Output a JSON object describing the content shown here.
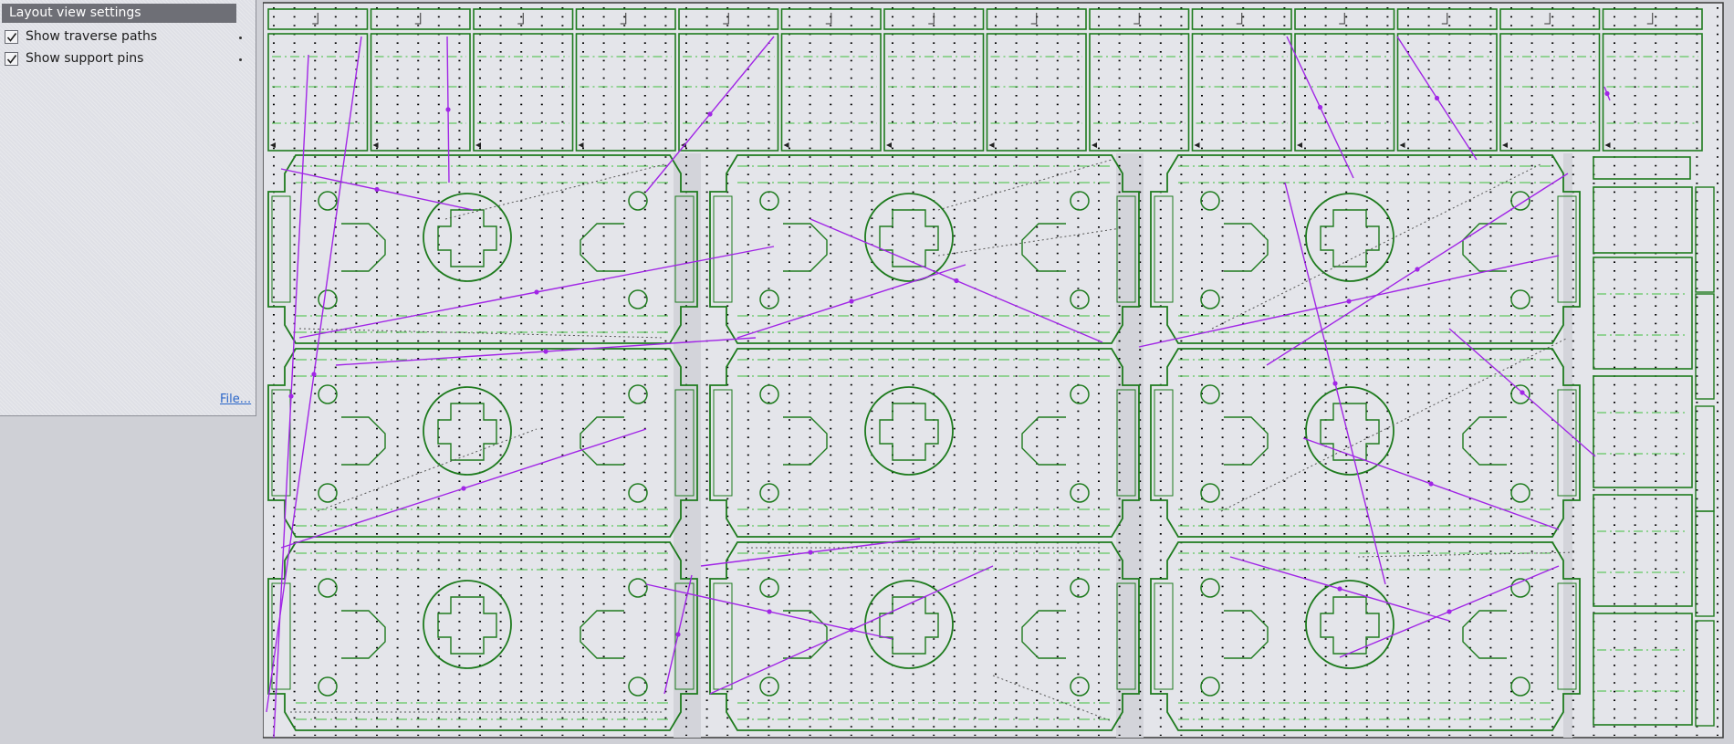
{
  "panel": {
    "title": "Layout view settings",
    "options": [
      {
        "label": "Show traverse paths",
        "checked": true
      },
      {
        "label": "Show support pins",
        "checked": true
      }
    ],
    "file_link": "File..."
  },
  "colors": {
    "part_outline": "#1e7b1e",
    "dash_line": "#3fbf3f",
    "traverse_path": "#a126e6",
    "support_pin": "#000000",
    "sheet_bg": "#e4e5ea"
  }
}
